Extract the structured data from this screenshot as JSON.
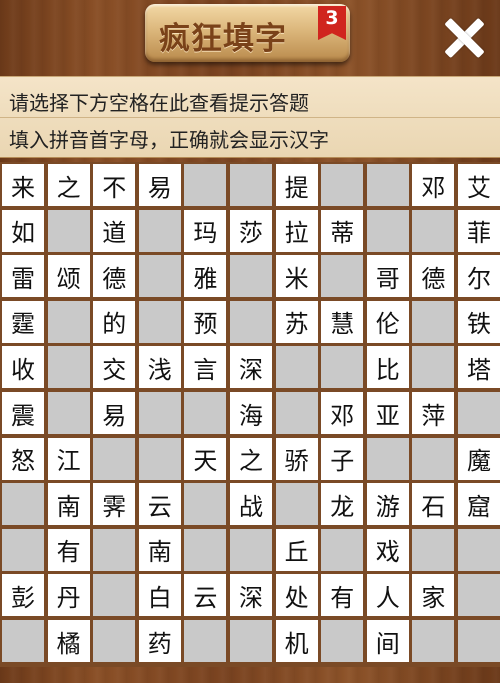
{
  "header": {
    "title": "疯狂填字",
    "level": "3",
    "close_icon": "close-icon"
  },
  "hint_panel": {
    "line1": "请选择下方空格在此查看提示答题",
    "line2": "填入拼音首字母，正确就会显示汉字"
  },
  "colors": {
    "wood": "#7a4320",
    "hint_bg": "#f0dfc0",
    "badge_red": "#d0251e",
    "blocked_cell": "#c9c9c9",
    "open_cell": "#ffffff"
  },
  "board": {
    "columns": 11,
    "rows": 11,
    "legend": "# = blocked cell, . = empty open cell",
    "rows_data": [
      [
        "来",
        "之",
        "不",
        "易",
        "#",
        "#",
        "提",
        "#",
        "#",
        "邓",
        "艾"
      ],
      [
        "如",
        "#",
        "道",
        "#",
        "玛",
        "莎",
        "拉",
        "蒂",
        "#",
        "#",
        "菲"
      ],
      [
        "雷",
        "颂",
        "德",
        "#",
        "雅",
        "#",
        "米",
        "#",
        "哥",
        "德",
        "尔"
      ],
      [
        "霆",
        "#",
        "的",
        "#",
        "预",
        "#",
        "苏",
        "慧",
        "伦",
        "#",
        "铁"
      ],
      [
        "收",
        "#",
        "交",
        "浅",
        "言",
        "深",
        "#",
        "#",
        "比",
        "#",
        "塔"
      ],
      [
        "震",
        "#",
        "易",
        "#",
        "#",
        "海",
        "#",
        "邓",
        "亚",
        "萍",
        "#"
      ],
      [
        "怒",
        "江",
        "#",
        "#",
        "天",
        "之",
        "骄",
        "子",
        "#",
        "#",
        "魔"
      ],
      [
        "#",
        "南",
        "霁",
        "云",
        "#",
        "战",
        "#",
        "龙",
        "游",
        "石",
        "窟"
      ],
      [
        "#",
        "有",
        "#",
        "南",
        "#",
        "#",
        "丘",
        "#",
        "戏",
        "#",
        "#"
      ],
      [
        "彭",
        "丹",
        "#",
        "白",
        "云",
        "深",
        "处",
        "有",
        "人",
        "家",
        "#"
      ],
      [
        "#",
        "橘",
        "#",
        "药",
        "#",
        "#",
        "机",
        "#",
        "间",
        "#",
        "#"
      ]
    ]
  }
}
